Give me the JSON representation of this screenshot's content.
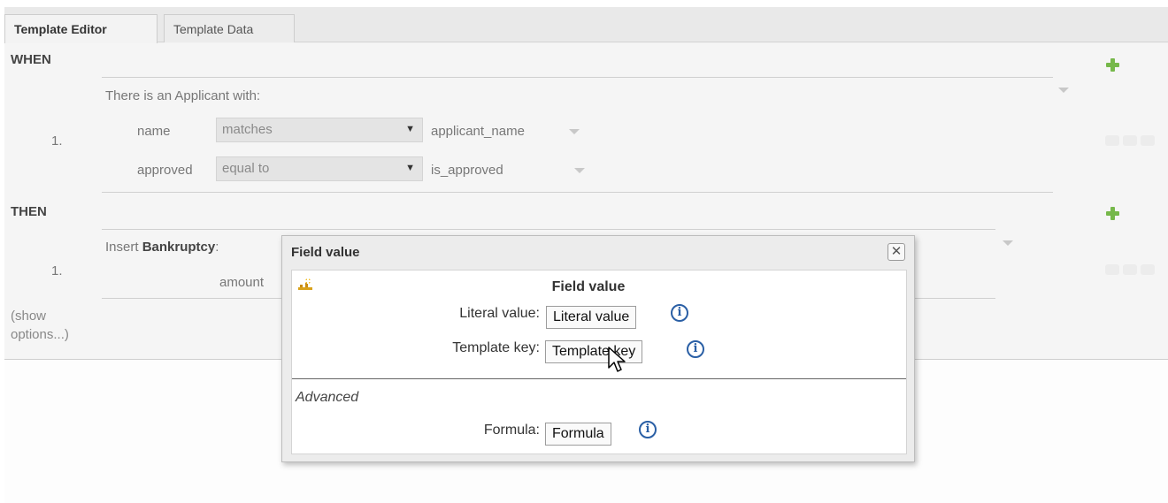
{
  "tabs": [
    {
      "label": "Template Editor",
      "active": true
    },
    {
      "label": "Template Data",
      "active": false
    }
  ],
  "when": {
    "label": "WHEN",
    "pattern_text": "There is an Applicant with:",
    "number": "1.",
    "constraints": [
      {
        "field": "name",
        "operator": "matches",
        "value": "applicant_name"
      },
      {
        "field": "approved",
        "operator": "equal to",
        "value": "is_approved"
      }
    ]
  },
  "then": {
    "label": "THEN",
    "number": "1.",
    "insert_prefix": "Insert",
    "insert_fact": "Bankruptcy",
    "insert_suffix": ":",
    "field": "amount"
  },
  "show_options": {
    "line1": "(show",
    "line2": "options...)"
  },
  "dialog": {
    "title": "Field value",
    "close_symbol": "✕",
    "heading": "Field value",
    "literal_label": "Literal value:",
    "literal_button": "Literal value",
    "template_label": "Template key:",
    "template_button": "Template key",
    "advanced_label": "Advanced",
    "formula_label": "Formula:",
    "formula_button": "Formula",
    "info_symbol": "i"
  },
  "icons": {
    "add": "add-icon",
    "info": "info-icon",
    "field_value": "field-value-icon",
    "dropdown": "dropdown-arrow-icon",
    "cursor": "mouse-pointer-icon"
  },
  "colors": {
    "add_green": "#76b84a",
    "info_blue": "#2a5fa5",
    "panel_bg": "#f5f5f5"
  }
}
